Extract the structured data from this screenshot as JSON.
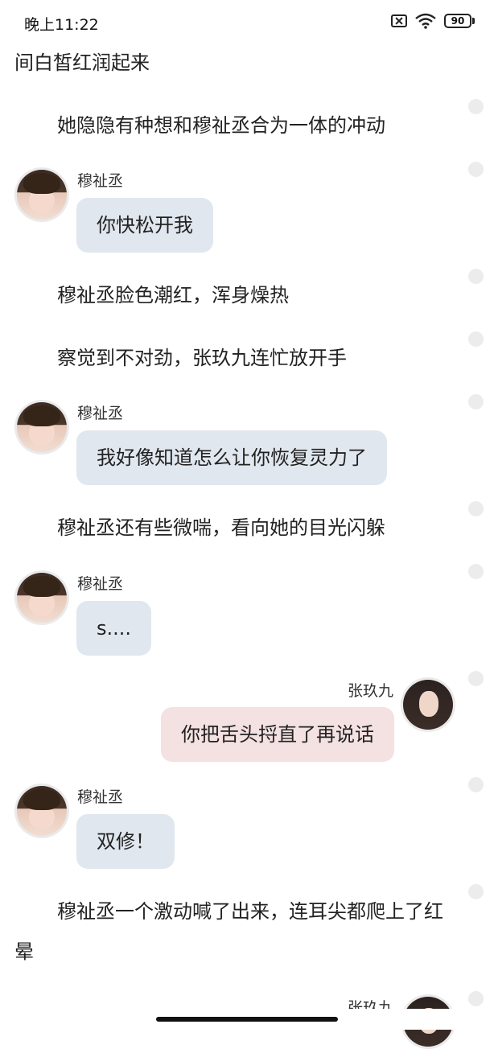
{
  "status_bar": {
    "time": "晚上11:22",
    "battery": "90",
    "icons": [
      "sim-icon",
      "wifi-icon",
      "battery-icon"
    ]
  },
  "story": {
    "top_line": "间白皙红润起来",
    "n1": "她隐隐有种想和穆祉丞合为一体的冲动",
    "n2": "穆祉丞脸色潮红，浑身燥热",
    "n3": "察觉到不对劲，张玖九连忙放开手",
    "n4": "穆祉丞还有些微喘，看向她的目光闪躲",
    "n5": "穆祉丞一个激动喊了出来，连耳尖都爬上了红晕"
  },
  "messages": [
    {
      "speaker": "穆祉丞",
      "text": "你快松开我"
    },
    {
      "speaker": "穆祉丞",
      "text": "我好像知道怎么让你恢复灵力了"
    },
    {
      "speaker": "穆祉丞",
      "text": "s...."
    },
    {
      "speaker": "张玖九",
      "text": "你把舌头捋直了再说话"
    },
    {
      "speaker": "穆祉丞",
      "text": "双修！"
    },
    {
      "speaker": "张玖九",
      "text": ""
    }
  ],
  "colors": {
    "bubble_left": "#e1e7ef",
    "bubble_right": "#f4e1e2",
    "dot": "#ececec"
  }
}
